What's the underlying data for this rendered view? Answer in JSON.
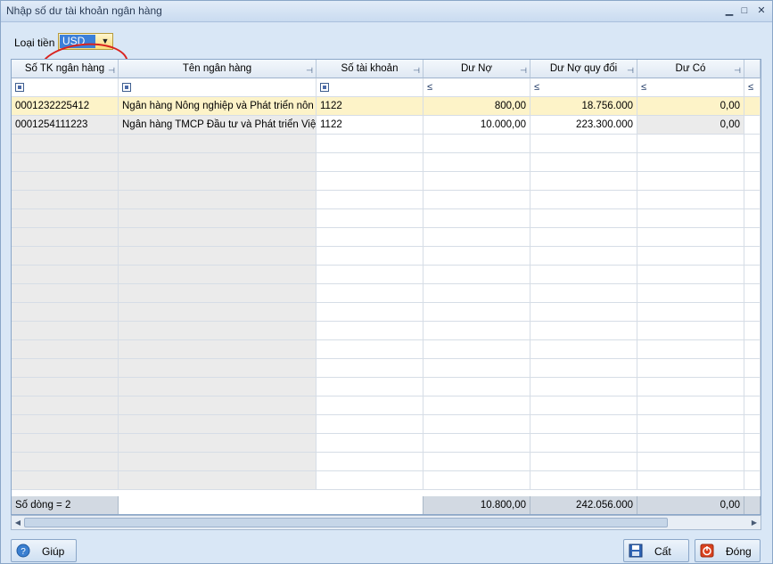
{
  "window": {
    "title": "Nhập số dư tài khoản ngân hàng"
  },
  "currency": {
    "label": "Loại tiền",
    "value": "USD"
  },
  "columns": [
    "Số TK ngân hàng",
    "Tên ngân hàng",
    "Số tài khoản",
    "Dư Nợ",
    "Dư Nợ quy đổi",
    "Dư Có"
  ],
  "filter": {
    "op": "≤"
  },
  "rows": [
    [
      "0001232225412",
      "Ngân hàng Nông nghiệp và Phát triển nôn",
      "1122",
      "800,00",
      "18.756.000",
      "0,00"
    ],
    [
      "0001254111223",
      "Ngân hàng TMCP Đầu tư và Phát triển Việ",
      "1122",
      "10.000,00",
      "223.300.000",
      "0,00"
    ]
  ],
  "footer": {
    "count": "Số dòng = 2",
    "du_no": "10.800,00",
    "du_no_quy_doi": "242.056.000",
    "du_co": "0,00"
  },
  "buttons": {
    "help": "Giúp",
    "save": "Cất",
    "close": "Đóng"
  }
}
